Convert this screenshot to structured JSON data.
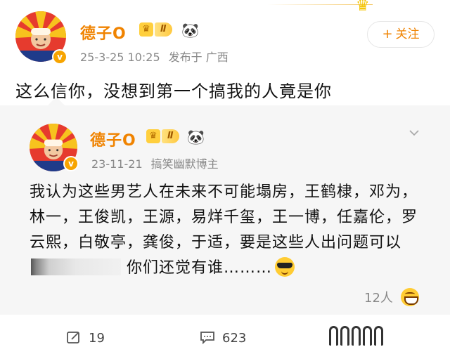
{
  "post": {
    "author_name": "德子O",
    "level_badge": "Ⅱ",
    "level_icon": "crown-icon",
    "date": "25-3-25 10:25",
    "location": "发布于 广西",
    "follow_label": "关注",
    "text": "这么信你，没想到第一个搞我的人竟是你"
  },
  "quoted": {
    "author_name": "德子O",
    "level_badge": "Ⅱ",
    "date": "23-11-21",
    "source": "搞笑幽默博主",
    "text_before_blur": "我认为这些男艺人在未来不可能塌房，王鹤棣，邓为，林一，王俊凯，王源，易烊千玺，王一博，任嘉伦，罗云熙，白敬亭，龚俊，于适，要是这些人出问题可以",
    "text_after_blur": "你们还觉有谁………",
    "likes": "12人"
  },
  "actions": {
    "repost_count": "19",
    "comment_count": "623"
  },
  "colors": {
    "name": "#f08300",
    "badge": "#ffc940",
    "card_bg": "#f6f6f6"
  }
}
